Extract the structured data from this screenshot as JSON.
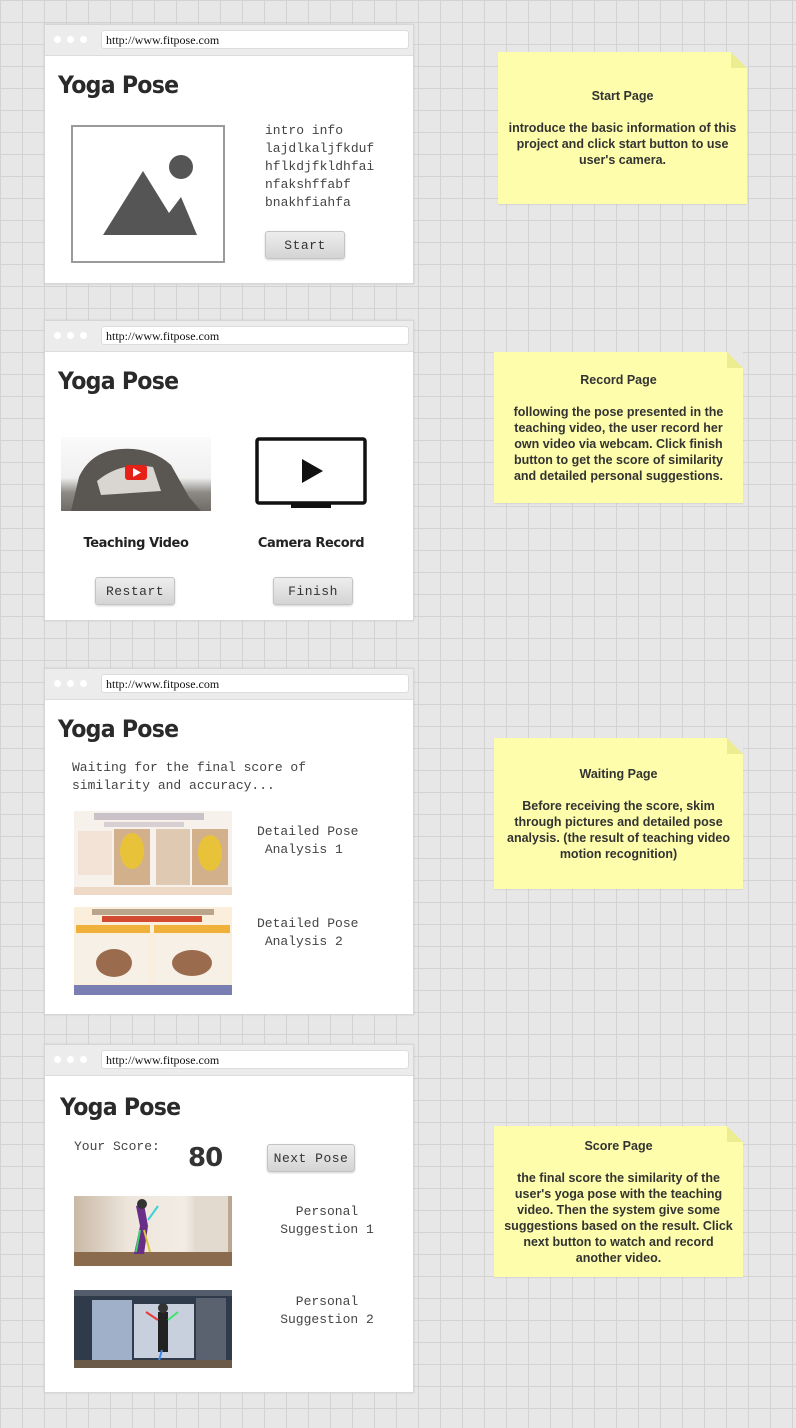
{
  "url": "http://www.fitpose.com",
  "app_title": "Yoga Pose",
  "start_page": {
    "intro_text": "intro info\nlajdlkaljfkduf\nhflkdjfkldhfai\nnfakshffabf\nbnakhfiahfa",
    "start_button": "Start",
    "image_icon": "image-placeholder-icon"
  },
  "record_page": {
    "teaching_caption": "Teaching Video",
    "camera_caption": "Camera Record",
    "restart_button": "Restart",
    "finish_button": "Finish",
    "play_icon": "play-icon",
    "monitor_icon": "monitor-icon"
  },
  "waiting_page": {
    "message": "Waiting for the final score of\nsimilarity and accuracy...",
    "analysis": [
      "Detailed Pose\n Analysis 1",
      "Detailed Pose\n Analysis 2"
    ]
  },
  "score_page": {
    "score_label": "Your Score:",
    "score_value": "80",
    "next_button": "Next Pose",
    "suggestions": [
      "Personal\nSuggestion 1",
      "Personal\nSuggestion 2"
    ]
  },
  "notes": {
    "start": {
      "title": "Start Page",
      "body": "introduce the basic information of this project and click start button to use user's camera."
    },
    "record": {
      "title": "Record Page",
      "body": "following the pose presented in the teaching video, the user record her own video via webcam. Click finish button to get the score of similarity and detailed personal suggestions."
    },
    "waiting": {
      "title": "Waiting Page",
      "body": "Before receiving the score, skim through pictures and  detailed pose analysis. (the result of teaching video motion recognition)"
    },
    "score": {
      "title": "Score Page",
      "body": "the final score the similarity of the user's yoga pose with the teaching video. Then the system give some suggestions based on the result. Click next button to watch and record another video."
    }
  },
  "colors": {
    "note_bg": "#fdfdac",
    "youtube_red": "#e62117"
  }
}
